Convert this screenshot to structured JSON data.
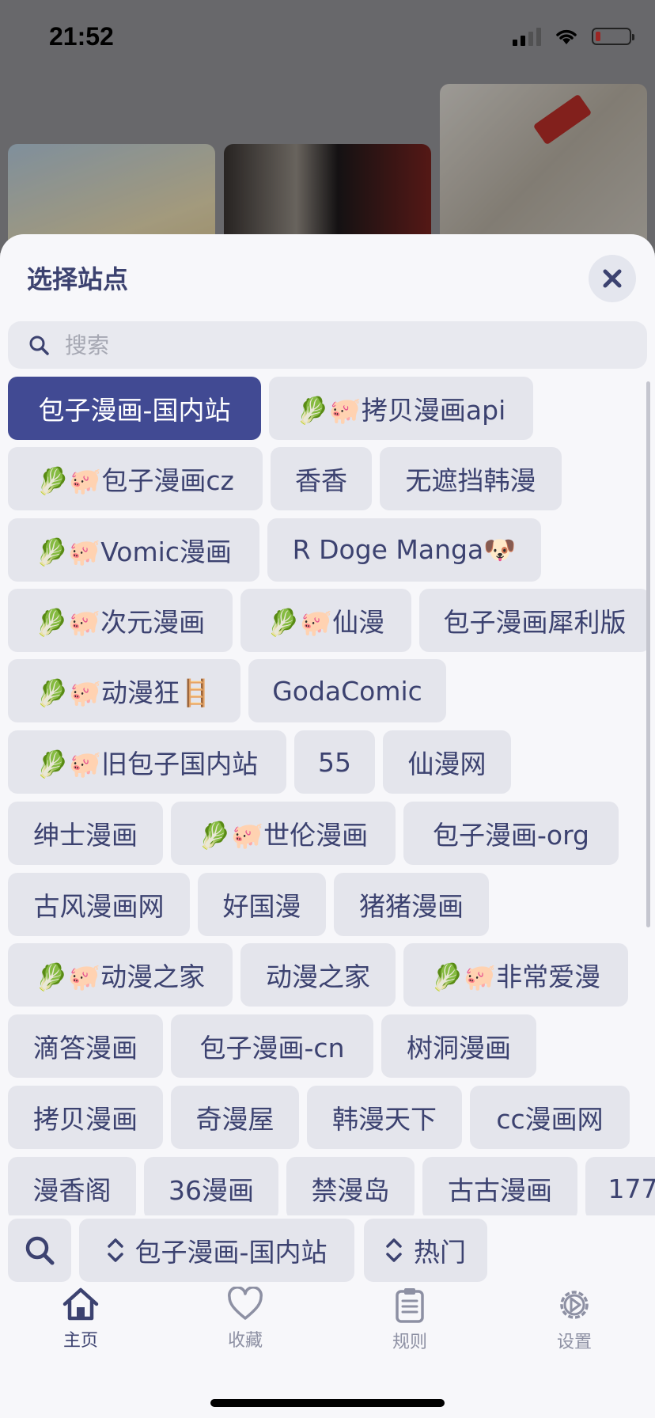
{
  "status_bar": {
    "time": "21:52"
  },
  "sheet": {
    "title": "选择站点",
    "search_placeholder": "搜索"
  },
  "sites": [
    [
      "包子漫画-国内站",
      "🥬🐖拷贝漫画api"
    ],
    [
      "🥬🐖包子漫画cz",
      "香香",
      "无遮挡韩漫"
    ],
    [
      "🥬🐖Vomic漫画",
      "R Doge Manga🐶"
    ],
    [
      "🥬🐖次元漫画",
      "🥬🐖仙漫",
      "包子漫画犀利版"
    ],
    [
      "🥬🐖动漫狂🪜",
      "GodaComic"
    ],
    [
      "🥬🐖旧包子国内站",
      "55",
      "仙漫网"
    ],
    [
      "绅士漫画",
      "🥬🐖世伦漫画",
      "包子漫画-org"
    ],
    [
      "古风漫画网",
      "好国漫",
      "猪猪漫画"
    ],
    [
      "🥬🐖动漫之家",
      "动漫之家",
      "🥬🐖非常爱漫"
    ],
    [
      "滴答漫画",
      "包子漫画-cn",
      "树洞漫画"
    ],
    [
      "拷贝漫画",
      "奇漫屋",
      "韩漫天下",
      "cc漫画网"
    ],
    [
      "漫香阁",
      "36漫画",
      "禁漫岛",
      "古古漫画",
      "177"
    ]
  ],
  "selected_site": "包子漫画-国内站",
  "controls": {
    "site_picker": "包子漫画-国内站",
    "sort_picker": "热门"
  },
  "tabs": [
    {
      "label": "主页",
      "icon": "home-icon",
      "active": true
    },
    {
      "label": "收藏",
      "icon": "heart-icon",
      "active": false
    },
    {
      "label": "规则",
      "icon": "clipboard-icon",
      "active": false
    },
    {
      "label": "设置",
      "icon": "gear-icon",
      "active": false
    }
  ],
  "colors": {
    "accent": "#414a93",
    "text": "#3c4270",
    "chip_bg": "#e4e5ec",
    "inactive": "#8d90a3"
  }
}
